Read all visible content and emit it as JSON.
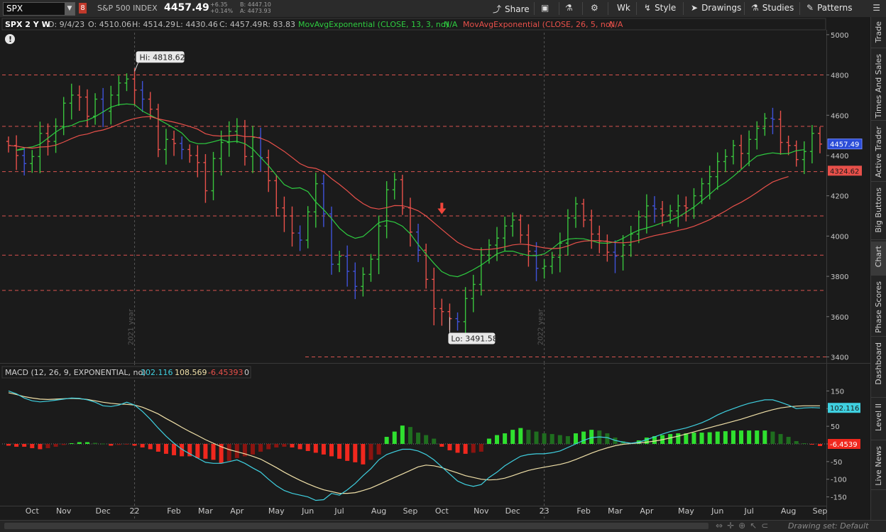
{
  "toolbar": {
    "symbol": "SPX",
    "badge": "8",
    "description": "S&P 500 INDEX",
    "last": "4457.49",
    "change": "+6.35",
    "change_pct": "+0.14%",
    "bid": "B: 4447.10",
    "ask": "A: 4473.93",
    "share": "Share",
    "wk": "Wk",
    "style": "Style",
    "drawings": "Drawings",
    "studies": "Studies",
    "patterns": "Patterns"
  },
  "sidebar": [
    "Trade",
    "Times And Sales",
    "Active Trader",
    "Big Buttons",
    "Chart",
    "Phase Scores",
    "Dashboard",
    "Level II",
    "Live News"
  ],
  "bottom": {
    "drawing_set": "Drawing set: Default"
  },
  "chart_data": [
    {
      "type": "ohlc",
      "header": {
        "title": "SPX 2 Y W",
        "date": "D: 9/4/23",
        "open": "O: 4510.06",
        "high": "H: 4514.29",
        "low": "L: 4430.46",
        "close": "C: 4457.49",
        "range": "R: 83.83",
        "ema1": "MovAvgExponential (CLOSE, 13, 3, no)",
        "ema1_val": "N/A",
        "ema2": "MovAvgExponential (CLOSE, 26, 5, no)",
        "ema2_val": "N/A"
      },
      "y_ticks": [
        3400,
        3600,
        3800,
        4000,
        4200,
        4400,
        4600,
        4800,
        5000
      ],
      "ylim": [
        3370,
        5010
      ],
      "x_labels": [
        {
          "week": 3,
          "label": "Oct"
        },
        {
          "week": 7,
          "label": "Nov"
        },
        {
          "week": 12,
          "label": "Dec"
        },
        {
          "week": 16,
          "label": "22"
        },
        {
          "week": 21,
          "label": "Feb"
        },
        {
          "week": 25,
          "label": "Mar"
        },
        {
          "week": 29,
          "label": "Apr"
        },
        {
          "week": 34,
          "label": "May"
        },
        {
          "week": 38,
          "label": "Jun"
        },
        {
          "week": 42,
          "label": "Jul"
        },
        {
          "week": 47,
          "label": "Aug"
        },
        {
          "week": 51,
          "label": "Sep"
        },
        {
          "week": 55,
          "label": "Oct"
        },
        {
          "week": 60,
          "label": "Nov"
        },
        {
          "week": 64,
          "label": "Dec"
        },
        {
          "week": 68,
          "label": "23"
        },
        {
          "week": 73,
          "label": "Feb"
        },
        {
          "week": 77,
          "label": "Mar"
        },
        {
          "week": 81,
          "label": "Apr"
        },
        {
          "week": 86,
          "label": "May"
        },
        {
          "week": 90,
          "label": "Jun"
        },
        {
          "week": 94,
          "label": "Jul"
        },
        {
          "week": 99,
          "label": "Aug"
        },
        {
          "week": 103,
          "label": "Sep"
        }
      ],
      "year_markers": [
        {
          "week": 16,
          "label": "2021 year"
        },
        {
          "week": 68,
          "label": "2022 year"
        }
      ],
      "levels": [
        4800,
        4545,
        4320,
        4100,
        3905,
        3730,
        3400
      ],
      "last_price": {
        "value": 4457.49,
        "label": "4457.49"
      },
      "ema_last": {
        "value": 4324.62,
        "label": "4324.62"
      },
      "hi_label": {
        "week": 16,
        "value": 4818.62,
        "text": "Hi: 4818.62"
      },
      "lo_label": {
        "week": 56,
        "value": 3491.58,
        "text": "Lo: 3491.58"
      },
      "arrow": {
        "week": 55,
        "value": 4130
      },
      "closes": [
        4450,
        4400,
        4360,
        4395,
        4510,
        4470,
        4545,
        4660,
        4700,
        4690,
        4595,
        4680,
        4620,
        4700,
        4760,
        4780,
        4725,
        4680,
        4630,
        4430,
        4480,
        4460,
        4430,
        4400,
        4365,
        4225,
        4385,
        4465,
        4520,
        4545,
        4395,
        4490,
        4390,
        4275,
        4140,
        4100,
        4015,
        3980,
        4120,
        4260,
        4110,
        3860,
        3900,
        3825,
        3750,
        3810,
        3885,
        4050,
        4230,
        4280,
        4140,
        4020,
        3930,
        3785,
        3640,
        3625,
        3590,
        3575,
        3690,
        3760,
        3905,
        3955,
        3990,
        4050,
        4080,
        4005,
        3925,
        3840,
        3850,
        3895,
        3965,
        4090,
        4160,
        4080,
        4010,
        3975,
        3920,
        3900,
        3955,
        4010,
        4095,
        4150,
        4135,
        4105,
        4125,
        4150,
        4140,
        4200,
        4260,
        4295,
        4370,
        4395,
        4450,
        4410,
        4480,
        4535,
        4585,
        4580,
        4465,
        4450,
        4380,
        4420,
        4510,
        4457
      ]
    },
    {
      "type": "macd",
      "header": {
        "title": "MACD (12, 26, 9, EXPONENTIAL, no)",
        "value": "102.116",
        "avg": "108.569",
        "diff": "-6.45393",
        "zero": "0"
      },
      "y_ticks": [
        150,
        100,
        50,
        0,
        -50,
        -100,
        -150
      ],
      "ylim": [
        -175,
        175
      ],
      "value_label": "102.116",
      "diff_label": "-6.4539",
      "macd": [
        150,
        142,
        130,
        122,
        119,
        121,
        124,
        127,
        130,
        129,
        125,
        118,
        108,
        106,
        110,
        118,
        110,
        92,
        70,
        45,
        22,
        2,
        -15,
        -28,
        -40,
        -52,
        -55,
        -55,
        -50,
        -45,
        -55,
        -68,
        -80,
        -100,
        -118,
        -132,
        -140,
        -145,
        -150,
        -160,
        -158,
        -140,
        -145,
        -130,
        -112,
        -90,
        -70,
        -45,
        -30,
        -22,
        -15,
        -15,
        -20,
        -30,
        -45,
        -65,
        -85,
        -105,
        -115,
        -120,
        -115,
        -95,
        -80,
        -62,
        -48,
        -35,
        -30,
        -28,
        -28,
        -25,
        -20,
        -10,
        0,
        10,
        18,
        20,
        18,
        10,
        5,
        2,
        5,
        12,
        20,
        28,
        35,
        40,
        45,
        52,
        60,
        70,
        82,
        92,
        100,
        108,
        115,
        120,
        125,
        125,
        118,
        110,
        100,
        102,
        103,
        102
      ],
      "signal": [
        145,
        140,
        134,
        130,
        127,
        126,
        127,
        128,
        129,
        128,
        126,
        122,
        118,
        115,
        113,
        112,
        110,
        104,
        95,
        85,
        72,
        60,
        47,
        35,
        24,
        12,
        2,
        -8,
        -16,
        -22,
        -28,
        -35,
        -43,
        -55,
        -67,
        -80,
        -92,
        -103,
        -113,
        -122,
        -130,
        -135,
        -140,
        -140,
        -138,
        -132,
        -125,
        -115,
        -105,
        -95,
        -85,
        -75,
        -65,
        -60,
        -62,
        -67,
        -75,
        -82,
        -90,
        -95,
        -100,
        -102,
        -101,
        -97,
        -90,
        -82,
        -75,
        -70,
        -66,
        -62,
        -58,
        -52,
        -44,
        -35,
        -26,
        -18,
        -11,
        -5,
        -1,
        1,
        3,
        5,
        8,
        12,
        17,
        22,
        28,
        34,
        40,
        46,
        52,
        58,
        64,
        70,
        77,
        84,
        91,
        97,
        102,
        105,
        107,
        108,
        108,
        108
      ],
      "hist": [
        -5,
        -8,
        -8,
        -12,
        -15,
        -12,
        -8,
        -3,
        2,
        5,
        5,
        3,
        1,
        -5,
        -3,
        -2,
        -5,
        -10,
        -15,
        -22,
        -28,
        -32,
        -35,
        -35,
        -40,
        -42,
        -45,
        -55,
        -48,
        -40,
        -35,
        -30,
        -22,
        -15,
        -10,
        -8,
        -10,
        -15,
        -20,
        -25,
        -30,
        -35,
        -42,
        -48,
        -52,
        -58,
        -45,
        -30,
        20,
        35,
        52,
        48,
        32,
        25,
        15,
        -8,
        -18,
        -25,
        -28,
        -25,
        -22,
        15,
        25,
        30,
        40,
        45,
        40,
        35,
        30,
        28,
        25,
        22,
        30,
        35,
        40,
        38,
        30,
        18,
        8,
        2,
        10,
        18,
        22,
        25,
        28,
        30,
        30,
        32,
        32,
        33,
        35,
        36,
        38,
        38,
        38,
        38,
        38,
        35,
        28,
        20,
        8,
        2,
        -2,
        -6
      ]
    }
  ]
}
